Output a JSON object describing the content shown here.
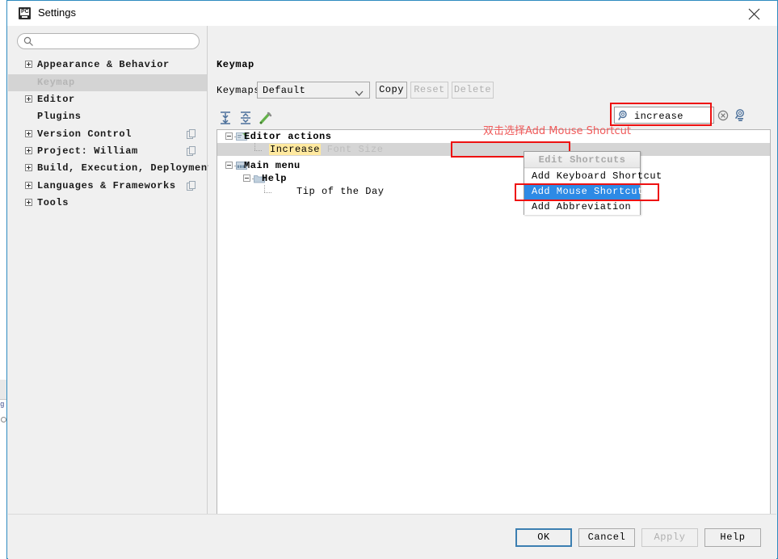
{
  "window": {
    "title": "Settings",
    "app_icon": "pycharm-icon",
    "close_label": "close-icon"
  },
  "sidebar": {
    "search": {
      "value": "",
      "placeholder": ""
    },
    "items": [
      {
        "label": "Appearance & Behavior",
        "expandable": true,
        "selected": false,
        "copy": false
      },
      {
        "label": "Keymap",
        "expandable": false,
        "selected": true,
        "copy": false
      },
      {
        "label": "Editor",
        "expandable": true,
        "selected": false,
        "copy": false
      },
      {
        "label": "Plugins",
        "expandable": false,
        "selected": false,
        "copy": false
      },
      {
        "label": "Version Control",
        "expandable": true,
        "selected": false,
        "copy": true
      },
      {
        "label": "Project: William",
        "expandable": true,
        "selected": false,
        "copy": true
      },
      {
        "label": "Build, Execution, Deployment",
        "expandable": true,
        "selected": false,
        "copy": false
      },
      {
        "label": "Languages & Frameworks",
        "expandable": true,
        "selected": false,
        "copy": true
      },
      {
        "label": "Tools",
        "expandable": true,
        "selected": false,
        "copy": false
      }
    ]
  },
  "main": {
    "page_title": "Keymap",
    "keymaps_label": "Keymaps:",
    "keymap_selected": "Default",
    "buttons": {
      "copy": "Copy",
      "reset": "Reset",
      "delete": "Delete"
    },
    "toolbar": {
      "expand_all": "expand-all-icon",
      "collapse_all": "collapse-all-icon",
      "edit": "edit-pencil-icon"
    },
    "find": {
      "value": "increase",
      "placeholder": "",
      "clear_label": "clear-icon",
      "filter_label": "filter-search-icon"
    },
    "tree": [
      {
        "label": "Editor actions",
        "depth": 0,
        "expanded": true,
        "icon": "editor-actions-icon",
        "selected": false
      },
      {
        "label": "Increase",
        "trailing": " Font Size",
        "depth": 1,
        "expanded": false,
        "icon": "",
        "selected": true,
        "highlight": true
      },
      {
        "label": "Main menu",
        "depth": 0,
        "expanded": true,
        "icon": "main-menu-icon",
        "selected": false
      },
      {
        "label": "Help",
        "depth": 1,
        "expanded": true,
        "icon": "folder-icon",
        "selected": false
      },
      {
        "label": "Tip of the Day",
        "depth": 2,
        "expanded": false,
        "icon": "",
        "selected": false
      }
    ],
    "annotation": "双击选择Add Mouse Shortcut",
    "context_menu": {
      "header": "Edit Shortcuts",
      "items": [
        {
          "label": "Add Keyboard Shortcut",
          "active": false
        },
        {
          "label": "Add Mouse Shortcut",
          "active": true
        },
        {
          "label": "Add Abbreviation",
          "active": false
        }
      ]
    }
  },
  "footer": {
    "ok": "OK",
    "cancel": "Cancel",
    "apply": "Apply",
    "help": "Help"
  },
  "colors": {
    "accent_blue": "#2d8ae5",
    "annotation_red": "#f05a5a",
    "highlight_yellow": "#ffe9a0",
    "selection_gray": "#d5d5d5",
    "window_border": "#2e8bc0"
  }
}
